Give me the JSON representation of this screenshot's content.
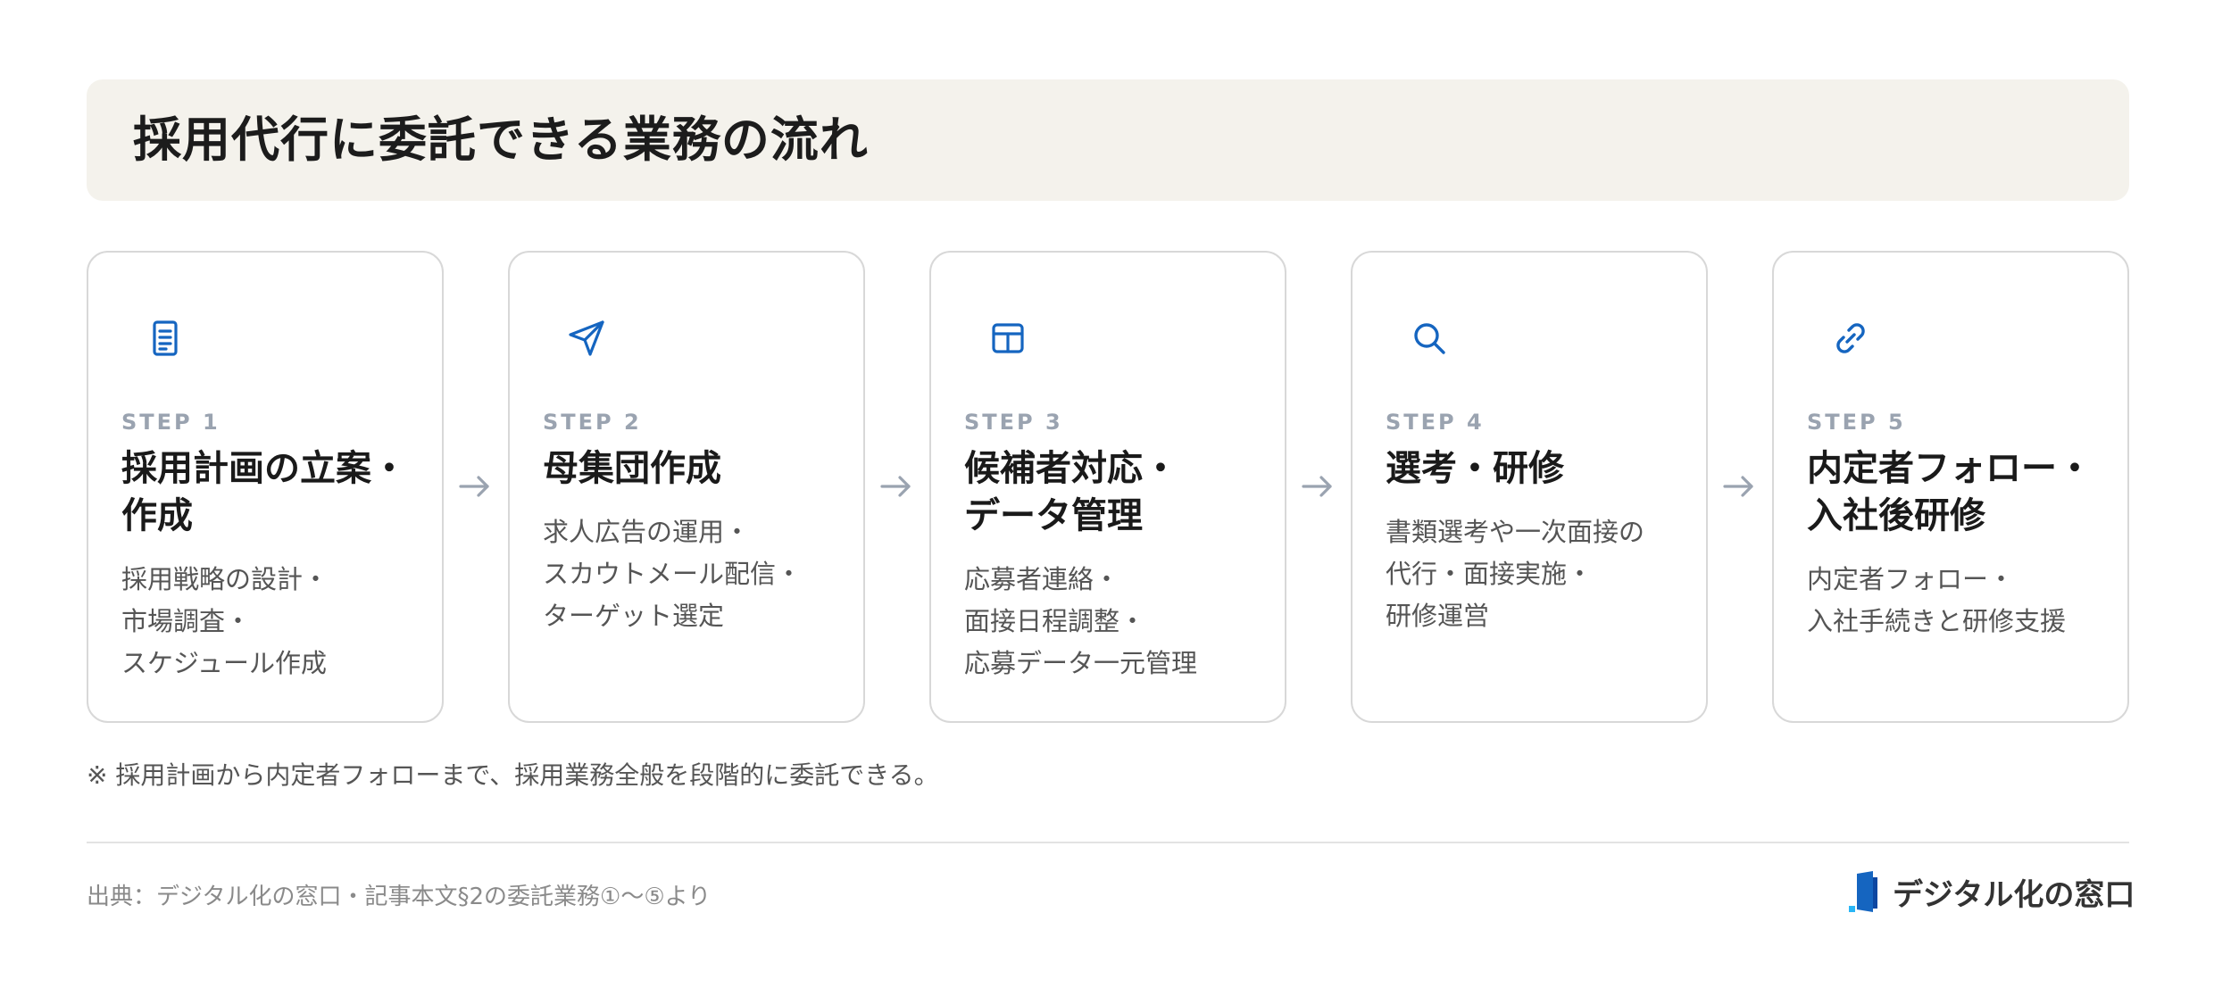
{
  "title": "採用代行に委託できる業務の流れ",
  "steps": [
    {
      "num": "STEP 1",
      "icon": "document-icon",
      "title": [
        "採用計画の立案・",
        "作成"
      ],
      "desc": [
        "採用戦略の設計・",
        "市場調査・",
        "スケジュール作成"
      ]
    },
    {
      "num": "STEP 2",
      "icon": "send-icon",
      "title": [
        "母集団作成"
      ],
      "desc": [
        "求人広告の運用・",
        "スカウトメール配信・",
        "ターゲット選定"
      ]
    },
    {
      "num": "STEP 3",
      "icon": "table-icon",
      "title": [
        "候補者対応・",
        "データ管理"
      ],
      "desc": [
        "応募者連絡・",
        "面接日程調整・",
        "応募データ一元管理"
      ]
    },
    {
      "num": "STEP 4",
      "icon": "search-icon",
      "title": [
        "選考・研修"
      ],
      "desc": [
        "書類選考や一次面接の",
        "代行・面接実施・",
        "研修運営"
      ]
    },
    {
      "num": "STEP 5",
      "icon": "link-icon",
      "title": [
        "内定者フォロー・",
        "入社後研修"
      ],
      "desc": [
        "内定者フォロー・",
        "入社手続きと研修支援"
      ]
    }
  ],
  "note": "※ 採用計画から内定者フォローまで、採用業務全般を段階的に委託できる。",
  "source": "出典：デジタル化の窓口・記事本文§2の委託業務①〜⑤より",
  "logo": {
    "text": "デジタル化の窓口",
    "icon": "logo-mark-icon"
  },
  "colors": {
    "accent": "#1565c0",
    "title_bg": "#f4f2ec",
    "step_label": "#9aa3b0",
    "arrow": "#9aa3b0"
  }
}
